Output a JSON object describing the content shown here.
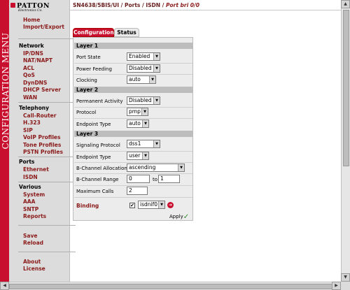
{
  "banner": {
    "text": "CONFIGURATION MENU"
  },
  "logo": {
    "main": "PATTON",
    "sub": "Electronics Co."
  },
  "breadcrumb": {
    "path": "SN4638/5BIS/UI / Ports / ISDN / ",
    "current": "Port bri 0/0"
  },
  "sidebar": {
    "home": "Home",
    "import_export": "Import/Export",
    "network_head": "Network",
    "network": [
      "IP/DNS",
      "NAT/NAPT",
      "ACL",
      "QoS",
      "DynDNS",
      "DHCP Server",
      "WAN"
    ],
    "telephony_head": "Telephony",
    "telephony": [
      "Call-Router",
      "H.323",
      "SIP",
      "VoIP Profiles",
      "Tone Profiles",
      "PSTN Profiles"
    ],
    "ports_head": "Ports",
    "ports": [
      "Ethernet",
      "ISDN"
    ],
    "various_head": "Various",
    "various": [
      "System",
      "AAA",
      "SNTP",
      "Reports"
    ],
    "save": "Save",
    "reload": "Reload",
    "about": "About",
    "license": "License"
  },
  "tabs": {
    "configuration": "Configuration",
    "status": "Status"
  },
  "layer1": {
    "title": "Layer 1",
    "port_state_label": "Port State",
    "port_state": "Enabled",
    "power_feeding_label": "Power Feeding",
    "power_feeding": "Disabled",
    "clocking_label": "Clocking",
    "clocking": "auto"
  },
  "layer2": {
    "title": "Layer 2",
    "permanent_activity_label": "Permanent Activity",
    "permanent_activity": "Disabled",
    "protocol_label": "Protocol",
    "protocol": "pmp",
    "endpoint_type_label": "Endpoint Type",
    "endpoint_type": "auto"
  },
  "layer3": {
    "title": "Layer 3",
    "signaling_protocol_label": "Signaling Protocol",
    "signaling_protocol": "dss1",
    "endpoint_type_label": "Endpoint Type",
    "endpoint_type": "user",
    "b_channel_allocation_label": "B-Channel Allocation",
    "b_channel_allocation": "ascending",
    "b_channel_range_label": "B-Channel Range",
    "b_channel_range_from": "0",
    "b_channel_range_to_label": "to",
    "b_channel_range_to": "1",
    "maximum_calls_label": "Maximum Calls",
    "maximum_calls": "2",
    "binding_label": "Binding",
    "binding_checked": "✔",
    "binding": "isdnif0"
  },
  "apply": {
    "label": "Apply"
  },
  "colors": {
    "brand_red": "#c8102e",
    "link_red": "#8b1a1a",
    "apply_green": "#2e8b2e"
  }
}
